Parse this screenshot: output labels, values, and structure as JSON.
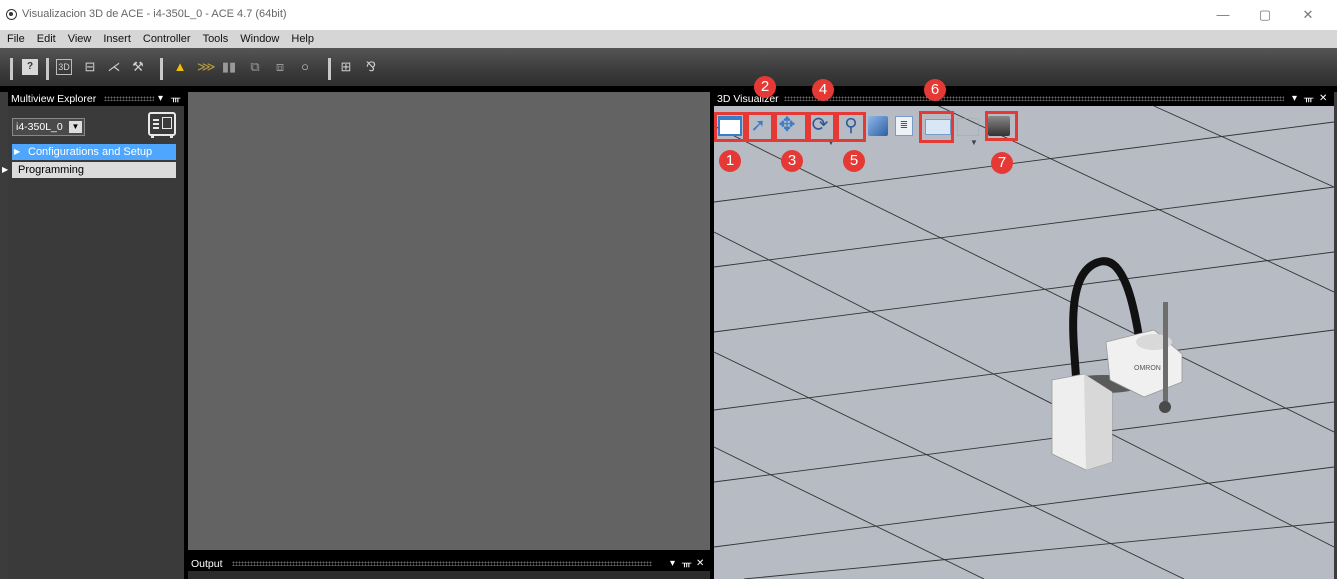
{
  "window": {
    "title": "Visualizacion 3D de ACE - i4-350L_0 - ACE 4.7 (64bit)",
    "minimize": "—",
    "restore": "▢",
    "close": "✕"
  },
  "menu": [
    "File",
    "Edit",
    "View",
    "Insert",
    "Controller",
    "Tools",
    "Window",
    "Help"
  ],
  "toolbar_icons": [
    "help-icon",
    "3d-view-icon",
    "layout-icon",
    "tools-icon",
    "connect-icon",
    "warning-icon",
    "program-icon",
    "pause-icon",
    "network-icon",
    "devices-icon",
    "refresh-icon",
    "monitor-icon",
    "variables-icon"
  ],
  "explorer": {
    "title": "Multiview Explorer",
    "controller_select": "i4-350L_0",
    "items": [
      "Configurations and Setup",
      "Programming"
    ]
  },
  "output": {
    "title": "Output"
  },
  "visualizer": {
    "title": "3D Visualizer",
    "callouts": [
      "1",
      "2",
      "3",
      "4",
      "5",
      "6",
      "7"
    ],
    "robot_brand": "OMRON"
  },
  "colors": {
    "highlight": "#e53935",
    "selected_item": "#4ea6ff",
    "floor": "#b7bbc4"
  }
}
